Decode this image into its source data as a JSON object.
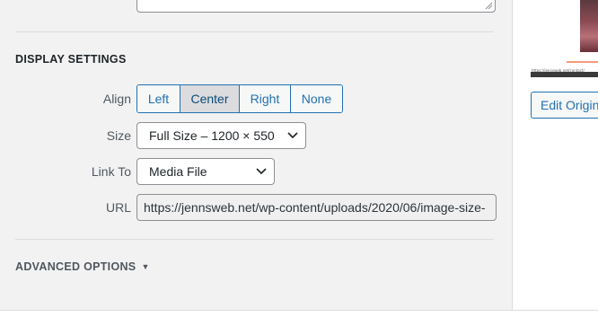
{
  "display_settings": {
    "title": "DISPLAY SETTINGS",
    "align": {
      "label": "Align",
      "options": [
        "Left",
        "Center",
        "Right",
        "None"
      ],
      "selected": "Center"
    },
    "size": {
      "label": "Size",
      "value": "Full Size – 1200 × 550"
    },
    "link_to": {
      "label": "Link To",
      "value": "Media File"
    },
    "url": {
      "label": "URL",
      "value": "https://jennsweb.net/wp-content/uploads/2020/06/image-size-"
    }
  },
  "advanced_options": {
    "title": "ADVANCED OPTIONS",
    "caret": "▼"
  },
  "sidebar": {
    "thumbnail_caption": "https://jennsweb.net/contact/",
    "edit_button_label": "Edit Original"
  },
  "colors": {
    "accent": "#2271b1",
    "panel_bg": "#f2f2f2"
  }
}
